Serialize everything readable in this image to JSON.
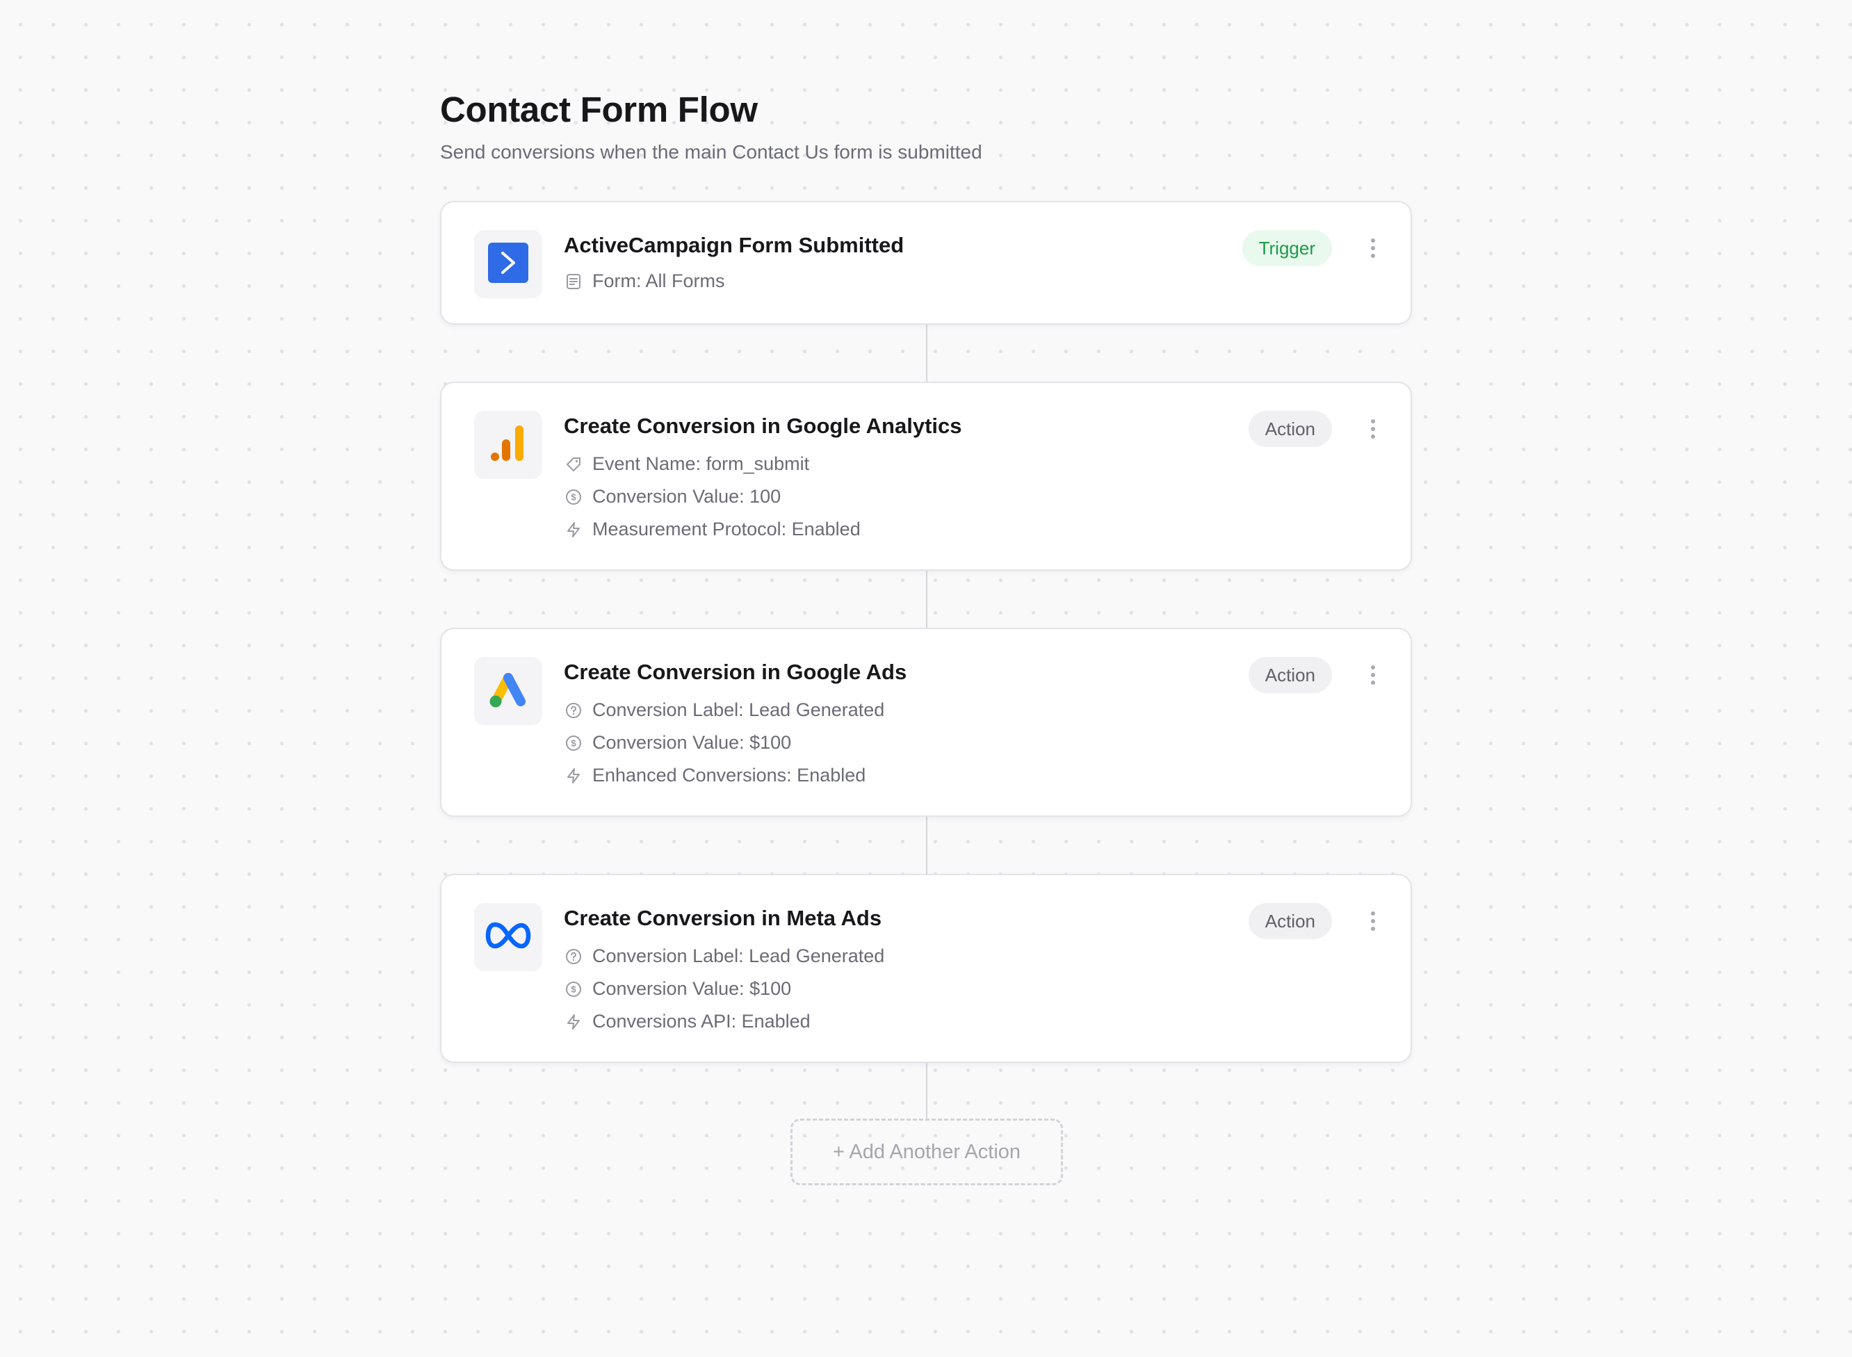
{
  "page": {
    "title": "Contact Form Flow",
    "subtitle": "Send conversions when the main Contact Us form is submitted"
  },
  "steps": [
    {
      "app_icon": "activecampaign-icon",
      "title": "ActiveCampaign Form Submitted",
      "badge": "Trigger",
      "details": [
        {
          "icon": "form-icon",
          "text": "Form: All Forms"
        }
      ]
    },
    {
      "app_icon": "google-analytics-icon",
      "title": "Create Conversion in Google Analytics",
      "badge": "Action",
      "details": [
        {
          "icon": "tag-icon",
          "text": "Event Name: form_submit"
        },
        {
          "icon": "dollar-circle-icon",
          "text": "Conversion Value: 100"
        },
        {
          "icon": "lightning-icon",
          "text": "Measurement Protocol: Enabled"
        }
      ]
    },
    {
      "app_icon": "google-ads-icon",
      "title": "Create Conversion in Google Ads",
      "badge": "Action",
      "details": [
        {
          "icon": "question-circle-icon",
          "text": "Conversion Label: Lead Generated"
        },
        {
          "icon": "dollar-circle-icon",
          "text": "Conversion Value: $100"
        },
        {
          "icon": "lightning-icon",
          "text": "Enhanced Conversions: Enabled"
        }
      ]
    },
    {
      "app_icon": "meta-icon",
      "title": "Create Conversion in Meta Ads",
      "badge": "Action",
      "details": [
        {
          "icon": "question-circle-icon",
          "text": "Conversion Label: Lead Generated"
        },
        {
          "icon": "dollar-circle-icon",
          "text": "Conversion Value: $100"
        },
        {
          "icon": "lightning-icon",
          "text": "Conversions API: Enabled"
        }
      ]
    }
  ],
  "add_action_label": "+ Add Another Action",
  "colors": {
    "trigger_badge_bg": "#e9f9ee",
    "trigger_badge_text": "#1d9a48",
    "action_badge_bg": "#f0f0f2",
    "activecampaign_blue": "#2f6be6",
    "google_analytics_orange": "#f9ab00",
    "google_ads_blue": "#4285f4",
    "google_ads_yellow": "#fbbc04",
    "google_ads_green": "#34a853",
    "meta_blue": "#0866ff"
  }
}
